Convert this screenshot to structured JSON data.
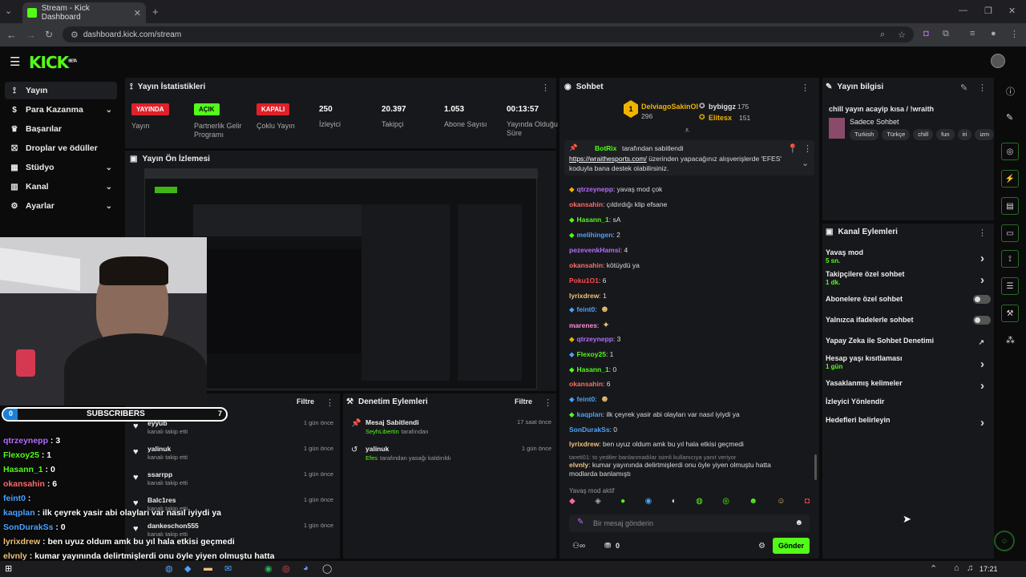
{
  "browser": {
    "tab_title": "Stream - Kick Dashboard",
    "url": "dashboard.kick.com/stream"
  },
  "app": {
    "logo": "KICK",
    "logo_sup": "BETA"
  },
  "sidebar": {
    "items": [
      {
        "label": "Yayın",
        "icon": "broadcast-icon"
      },
      {
        "label": "Para Kazanma",
        "icon": "dollar-icon"
      },
      {
        "label": "Başarılar",
        "icon": "trophy-icon"
      },
      {
        "label": "Droplar ve ödüller",
        "icon": "gift-icon"
      },
      {
        "label": "Stüdyo",
        "icon": "studio-icon"
      },
      {
        "label": "Kanal",
        "icon": "channel-icon"
      },
      {
        "label": "Ayarlar",
        "icon": "gear-icon"
      }
    ]
  },
  "stats": {
    "title": "Yayın İstatistikleri",
    "items": [
      {
        "badge": "YAYINDA",
        "label": "Yayın"
      },
      {
        "badge": "AÇIK",
        "label": "Partnerlik Gelir Programı"
      },
      {
        "badge": "KAPALI",
        "label": "Çoklu Yayın"
      },
      {
        "value": "250",
        "label": "İzleyici"
      },
      {
        "value": "20.397",
        "label": "Takipçi"
      },
      {
        "value": "1.053",
        "label": "Abone Sayısı"
      },
      {
        "value": "00:13:57",
        "label": "Yayında Olduğu Süre"
      }
    ]
  },
  "preview": {
    "title": "Yayın Ön İzlemesi"
  },
  "activity": {
    "filter_label": "Filtre",
    "items": [
      {
        "user": "eyyub",
        "action": "kanalı takip etti",
        "time": "1 gün önce"
      },
      {
        "user": "yalinuk",
        "action": "kanalı takip etti",
        "time": "1 gün önce"
      },
      {
        "user": "ssarrpp",
        "action": "kanalı takip etti",
        "time": "1 gün önce"
      },
      {
        "user": "Balc1res",
        "action": "kanalı takip etti",
        "time": "1 gün önce"
      },
      {
        "user": "dankeschon555",
        "action": "kanalı takip etti",
        "time": "1 gün önce"
      }
    ]
  },
  "moderation": {
    "title": "Denetim Eylemleri",
    "filter_label": "Filtre",
    "items": [
      {
        "title": "Mesaj Sabitlendi",
        "by": "SeyhLibertin",
        "suffix": "tarafından",
        "time": "17 saat önce"
      },
      {
        "title": "yalinuk",
        "by": "Efes",
        "suffix": "tarafından yasağı kaldırıldı",
        "time": "1 gün önce"
      }
    ]
  },
  "chat": {
    "title": "Sohbet",
    "top_gifters": [
      {
        "name": "DelviagoSakinOl",
        "count": "296"
      },
      {
        "name": "bybiggz",
        "count": "175"
      },
      {
        "name": "Elitesx",
        "count": "151"
      }
    ],
    "pinned": {
      "user": "BotRix",
      "by_text": "tarafından sabitlendi",
      "link": "https://wraithesports.com/",
      "text": " üzerinden yapacağınız alışverişlerde 'EFES' koduyla bana destek olabilirsiniz."
    },
    "messages": [
      {
        "user": "qtrzeynepp",
        "text": ": yavaş mod çok",
        "color": "#b56cff"
      },
      {
        "user": "okansahin",
        "text": ": çıldırdığı klip efsane",
        "color": "#ff6b6b"
      },
      {
        "user": "Hasann_1",
        "text": ": sA",
        "color": "#53fc18"
      },
      {
        "user": "melihingen",
        "text": ": 2",
        "color": "#4aa3ff"
      },
      {
        "user": "pezevenkHamsi",
        "text": ": 4",
        "color": "#b56cff"
      },
      {
        "user": "okansahin",
        "text": ": kötüydü ya",
        "color": "#ff6b6b"
      },
      {
        "user": "Poku1O1",
        "text": ": 6",
        "color": "#ff4d4d"
      },
      {
        "user": "lyrixdrew",
        "text": ": 1",
        "color": "#f0c27b"
      },
      {
        "user": "feint0",
        "text": ":",
        "color": "#4aa3ff"
      },
      {
        "user": "marenes",
        "text": ":",
        "color": "#ff8ad8"
      },
      {
        "user": "qtrzeynepp",
        "text": ": 3",
        "color": "#b56cff"
      },
      {
        "user": "Flexoy25",
        "text": ": 1",
        "color": "#53fc18"
      },
      {
        "user": "Hasann_1",
        "text": ": 0",
        "color": "#53fc18"
      },
      {
        "user": "okansahin",
        "text": ": 6",
        "color": "#ff6b6b"
      },
      {
        "user": "feint0",
        "text": ":",
        "color": "#4aa3ff"
      },
      {
        "user": "kaqplan",
        "text": ": ilk çeyrek yasir abi olayları var nasıl iyiydi ya",
        "color": "#4aa3ff"
      },
      {
        "user": "SonDurakSs",
        "text": ": 0",
        "color": "#4aa3ff"
      },
      {
        "user": "lyrixdrew",
        "text": ": ben uyuz oldum amk bu yıl hala etkisi geçmedi",
        "color": "#f0c27b"
      }
    ],
    "reply_note": "tareti01: to yediler banlanmadılar isimli kullanıcıya yanıt veriyor",
    "last_message": {
      "user": "elvnly",
      "text": ": kumar yayınında delirtmişlerdi onu öyle yiyen olmuştu hatta modlarda banlamıştı",
      "color": "#f0c27b"
    },
    "slow_mode": "Yavaş mod aktif",
    "input_placeholder": "Bir mesaj gönderin",
    "points": "0",
    "send_label": "Gönder"
  },
  "stream_info": {
    "title": "Yayın bilgisi",
    "stream_title": "chill yayın acayip kısa / !wraith",
    "category": "Sadece Sohbet",
    "tags": [
      "Turkish",
      "Türkçe",
      "chill",
      "fun",
      "iri",
      "izm"
    ]
  },
  "channel_actions": {
    "title": "Kanal Eylemleri",
    "rows": [
      {
        "label": "Yavaş mod",
        "sub": "5 sn.",
        "control": "chevron"
      },
      {
        "label": "Takipçilere özel sohbet",
        "sub": "1 dk.",
        "control": "chevron"
      },
      {
        "label": "Abonelere özel sohbet",
        "sub": "",
        "control": "toggle"
      },
      {
        "label": "Yalnızca ifadelerle sohbet",
        "sub": "",
        "control": "toggle"
      },
      {
        "label": "Yapay Zeka ile Sohbet Denetimi",
        "sub": "",
        "control": "external"
      },
      {
        "label": "Hesap yaşı kısıtlaması",
        "sub": "1 gün",
        "control": "chevron"
      },
      {
        "label": "Yasaklanmış kelimeler",
        "sub": "",
        "control": "chevron"
      },
      {
        "label": "İzleyici Yönlendir",
        "sub": "",
        "control": "none"
      },
      {
        "label": "Hedefleri belirleyin",
        "sub": "",
        "control": "chevron"
      }
    ]
  },
  "overlay": {
    "sub_count_left": "0",
    "sub_label": "SUBSCRIBERS",
    "sub_count_right": "7",
    "lines": [
      {
        "user": "qtrzeynepp",
        "text": " : 3",
        "color": "#b56cff"
      },
      {
        "user": "Flexoy25",
        "text": " : 1",
        "color": "#53fc18"
      },
      {
        "user": "Hasann_1",
        "text": " : 0",
        "color": "#53fc18"
      },
      {
        "user": "okansahin",
        "text": " : 6",
        "color": "#ff6b6b"
      },
      {
        "user": "feint0",
        "text": " :",
        "color": "#4aa3ff"
      },
      {
        "user": "kaqplan",
        "text": " : ilk çeyrek yasir abi olayları var nasıl iyiydi ya",
        "color": "#4aa3ff"
      },
      {
        "user": "SonDurakSs",
        "text": " : 0",
        "color": "#4aa3ff"
      },
      {
        "user": "lyrixdrew",
        "text": " : ben uyuz oldum amk bu yıl hala etkisi geçmedi",
        "color": "#f0c27b"
      },
      {
        "user": "elvnly",
        "text": " : kumar yayınında delirtmişlerdi onu öyle yiyen olmuştu hatta",
        "color": "#f0c27b"
      },
      {
        "user": "",
        "text": "modlarda banlamıştı",
        "color": "#fff"
      }
    ]
  },
  "taskbar": {
    "time": "17:21"
  },
  "colors": {
    "accent": "#53fc18",
    "live": "#e0212a",
    "panel": "#17181b"
  }
}
